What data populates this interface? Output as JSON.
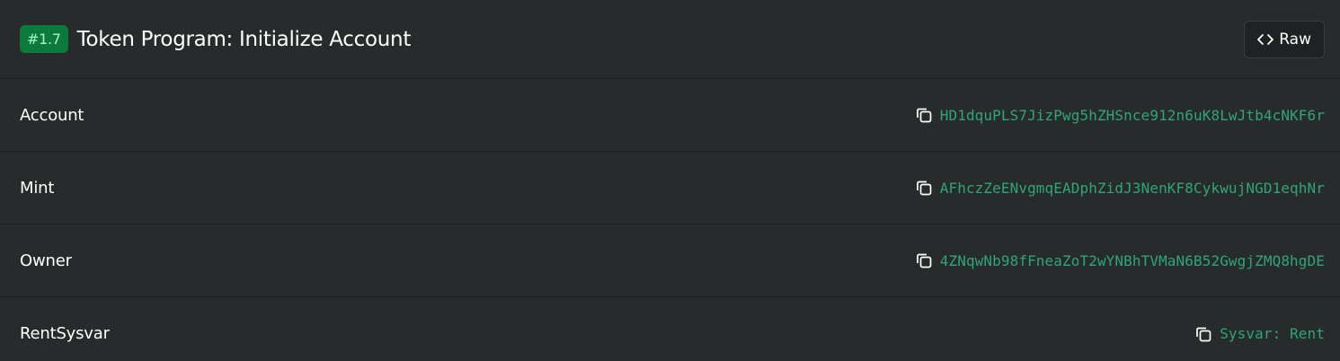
{
  "header": {
    "badge": "#1.7",
    "title": "Token Program: Initialize Account",
    "raw_label": "Raw"
  },
  "rows": [
    {
      "label": "Account",
      "value": "HD1dquPLS7JizPwg5hZHSnce912n6uK8LwJtb4cNKF6r"
    },
    {
      "label": "Mint",
      "value": "AFhczZeENvgmqEADphZidJ3NenKF8CykwujNGD1eqhNr"
    },
    {
      "label": "Owner",
      "value": "4ZNqwNb98fFneaZoT2wYNBhTVMaN6B52GwgjZMQ8hgDE"
    },
    {
      "label": "RentSysvar",
      "value": "Sysvar: Rent"
    }
  ],
  "colors": {
    "background": "#282b2b",
    "badge_bg": "#0c7a3b",
    "badge_text": "#a6f4c0",
    "address": "#2fa578"
  },
  "icons": {
    "raw": "code-icon",
    "copy": "copy-icon"
  }
}
